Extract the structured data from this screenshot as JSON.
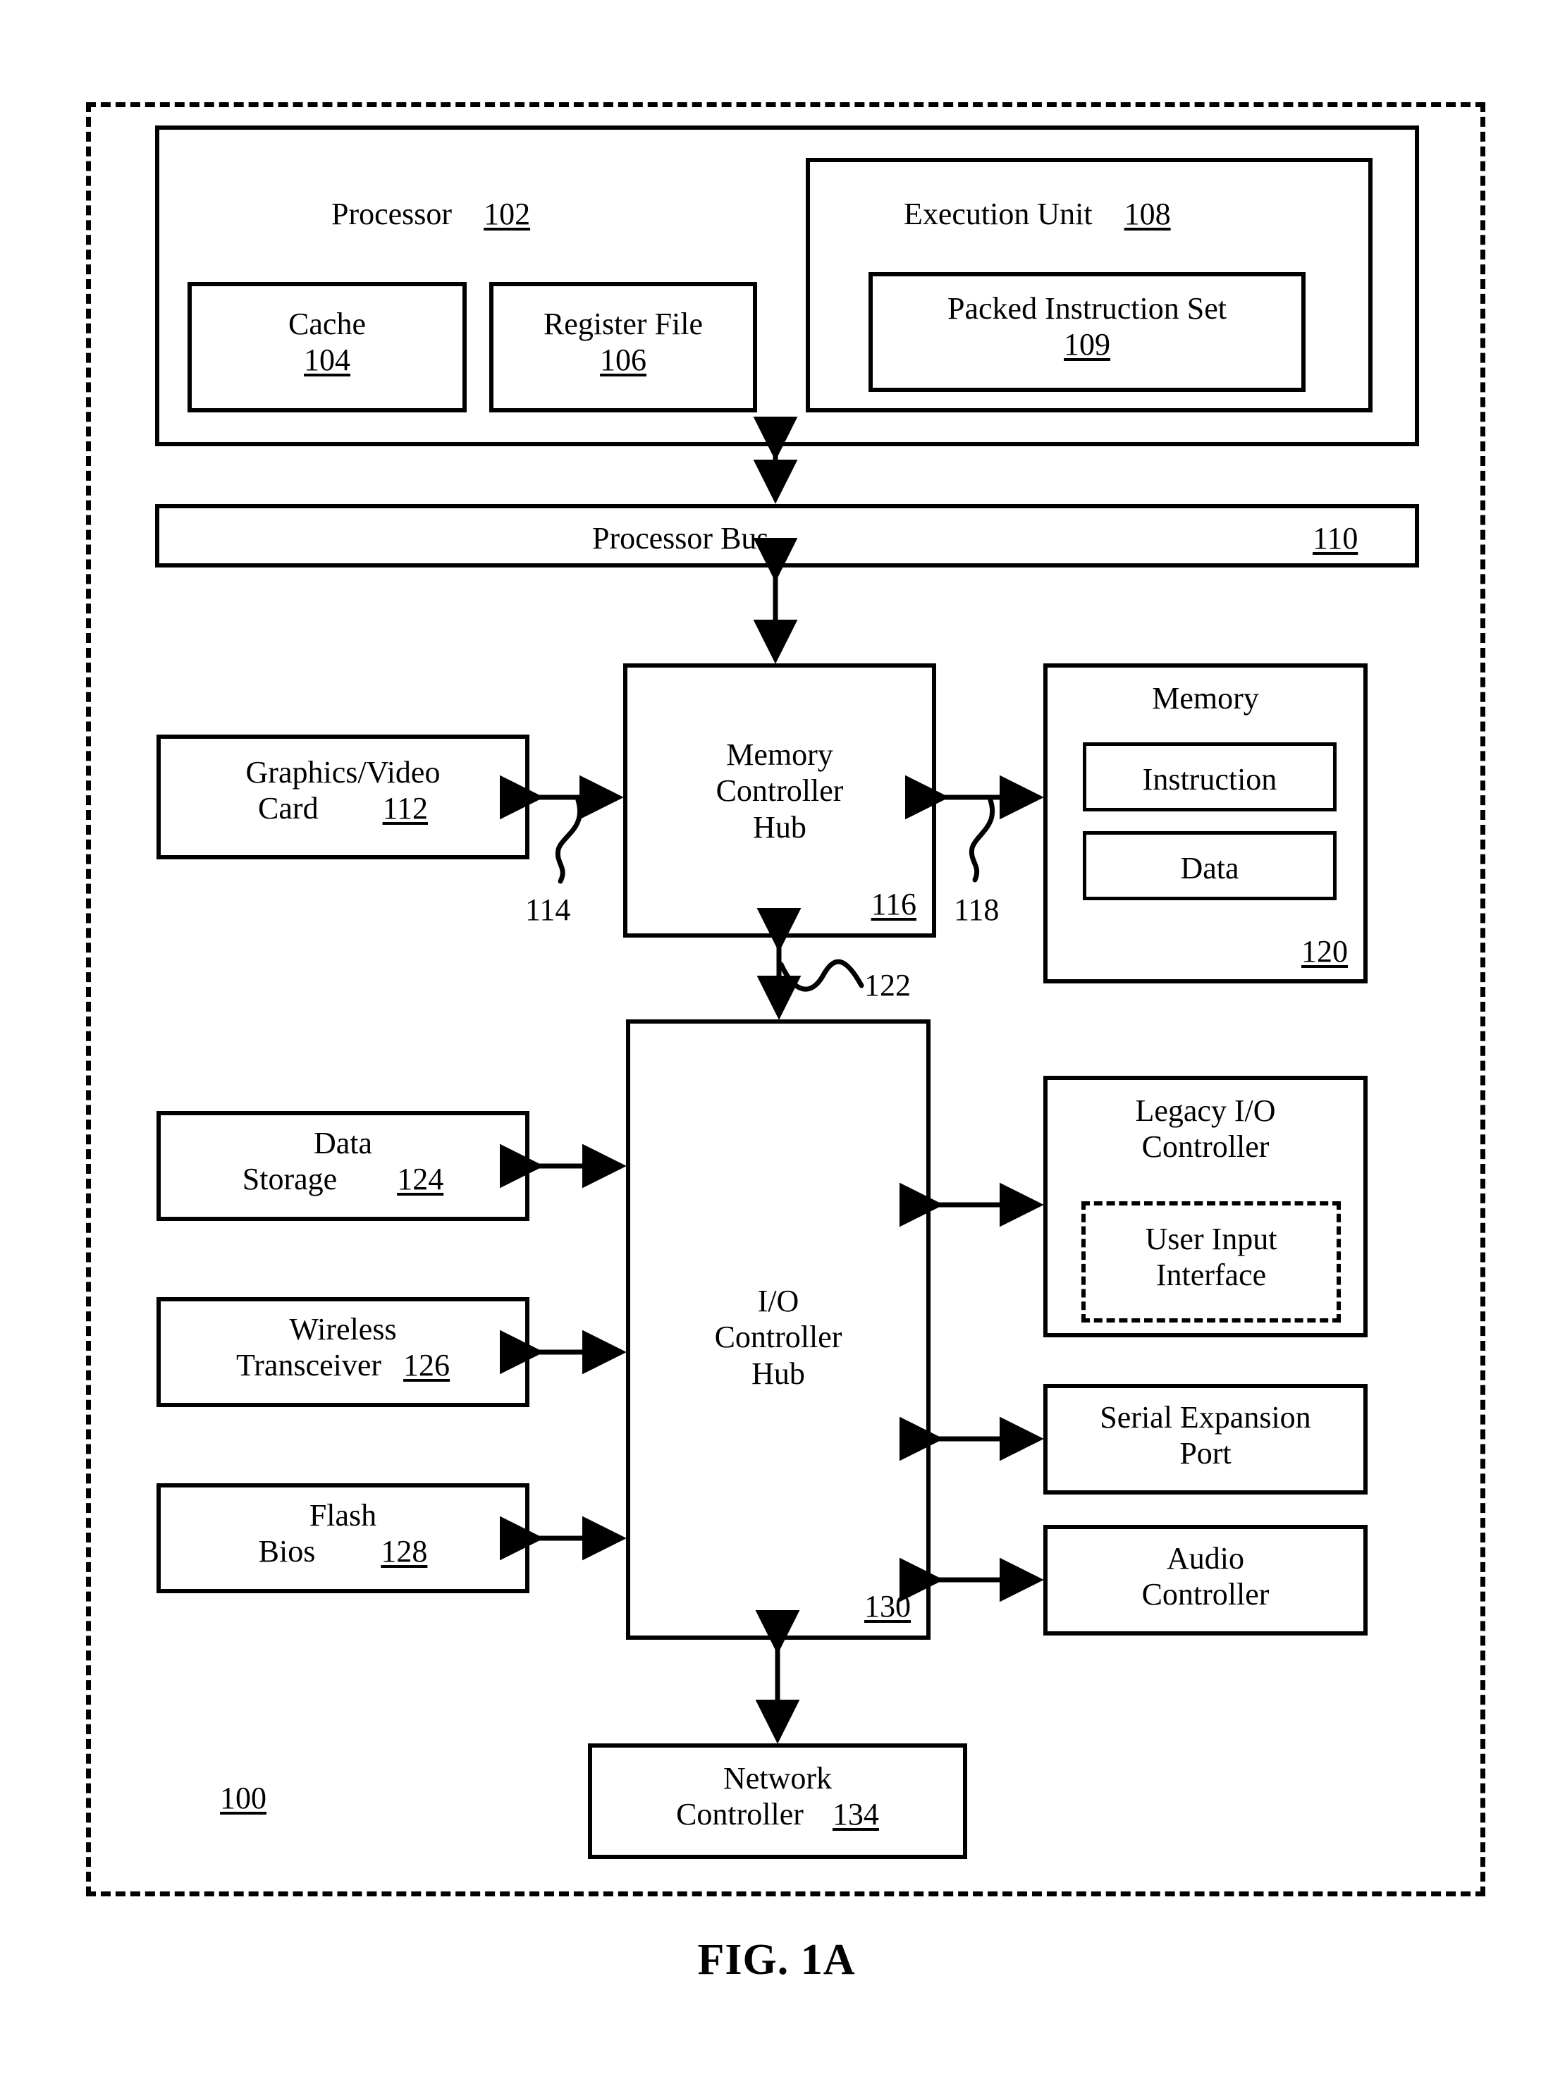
{
  "figure": {
    "caption": "FIG. 1A",
    "system_ref": "100"
  },
  "processor": {
    "label": "Processor",
    "ref": "102",
    "cache": {
      "label": "Cache",
      "ref": "104"
    },
    "register_file": {
      "label": "Register File",
      "ref": "106"
    },
    "execution_unit": {
      "label": "Execution Unit",
      "ref": "108",
      "packed_instruction_set": {
        "label": "Packed Instruction Set",
        "ref": "109"
      }
    }
  },
  "processor_bus": {
    "label": "Processor Bus",
    "ref": "110"
  },
  "graphics_card": {
    "line1": "Graphics/Video",
    "line2": "Card",
    "ref": "112"
  },
  "graphics_link_ref": "114",
  "memory_controller_hub": {
    "line1": "Memory",
    "line2": "Controller",
    "line3": "Hub",
    "ref": "116"
  },
  "memory_link_ref": "118",
  "memory": {
    "label": "Memory",
    "ref": "120",
    "instruction": {
      "label": "Instruction"
    },
    "data": {
      "label": "Data"
    }
  },
  "hub_interface_ref": "122",
  "data_storage": {
    "line1": "Data",
    "line2": "Storage",
    "ref": "124"
  },
  "wireless_transceiver": {
    "line1": "Wireless",
    "line2": "Transceiver",
    "ref": "126"
  },
  "flash_bios": {
    "line1": "Flash",
    "line2": "Bios",
    "ref": "128"
  },
  "io_controller_hub": {
    "line1": "I/O",
    "line2": "Controller",
    "line3": "Hub",
    "ref": "130"
  },
  "legacy_io_controller": {
    "line1": "Legacy I/O",
    "line2": "Controller",
    "user_input_interface": {
      "line1": "User Input",
      "line2": "Interface"
    }
  },
  "serial_expansion_port": {
    "line1": "Serial Expansion",
    "line2": "Port"
  },
  "audio_controller": {
    "line1": "Audio",
    "line2": "Controller"
  },
  "network_controller": {
    "line1": "Network",
    "line2": "Controller",
    "ref": "134"
  }
}
